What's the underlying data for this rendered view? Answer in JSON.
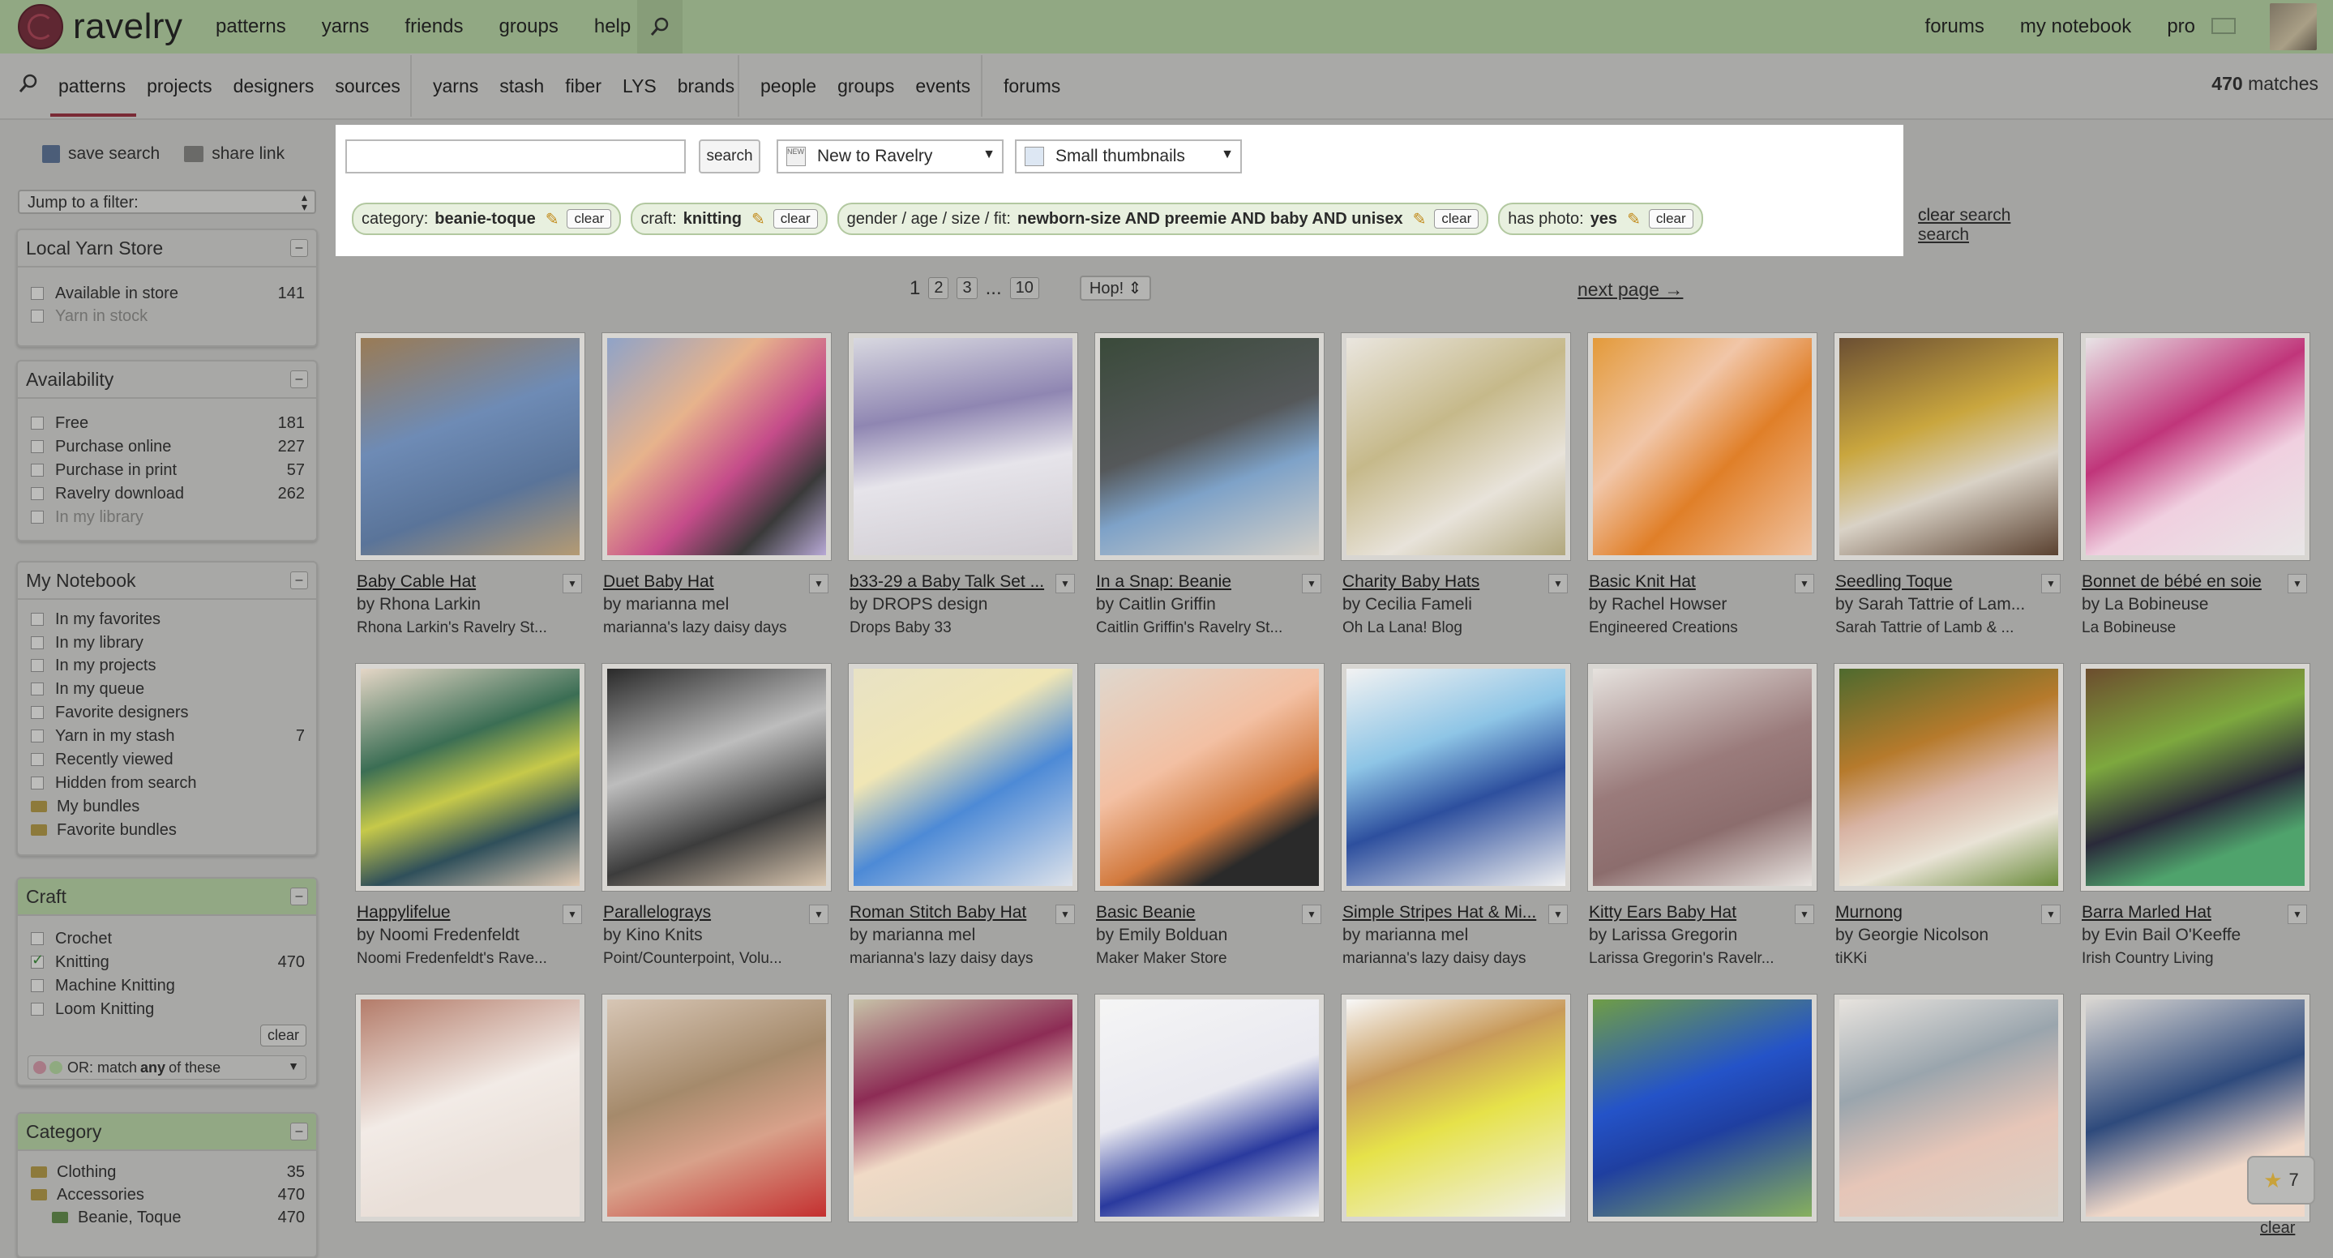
{
  "brand": "ravelry",
  "topnav": [
    "patterns",
    "yarns",
    "friends",
    "groups",
    "help"
  ],
  "topright": [
    "forums",
    "my notebook",
    "pro"
  ],
  "subnav": {
    "g1": [
      "patterns",
      "projects",
      "designers",
      "sources"
    ],
    "g2": [
      "yarns",
      "stash",
      "fiber",
      "LYS",
      "brands"
    ],
    "g3": [
      "people",
      "groups",
      "events"
    ],
    "g4": [
      "forums"
    ]
  },
  "matches": {
    "count": "470",
    "label": "matches"
  },
  "sidebar": {
    "save_search": "save search",
    "share_link": "share link",
    "jump": "Jump to a filter:",
    "lys": {
      "title": "Local Yarn Store",
      "items": [
        {
          "label": "Available in store",
          "count": "141"
        },
        {
          "label": "Yarn in stock",
          "count": ""
        }
      ]
    },
    "availability": {
      "title": "Availability",
      "items": [
        {
          "label": "Free",
          "count": "181"
        },
        {
          "label": "Purchase online",
          "count": "227"
        },
        {
          "label": "Purchase in print",
          "count": "57"
        },
        {
          "label": "Ravelry download",
          "count": "262"
        },
        {
          "label": "In my library",
          "count": ""
        }
      ]
    },
    "notebook": {
      "title": "My Notebook",
      "items": [
        {
          "label": "In my favorites",
          "count": ""
        },
        {
          "label": "In my library",
          "count": ""
        },
        {
          "label": "In my projects",
          "count": ""
        },
        {
          "label": "In my queue",
          "count": ""
        },
        {
          "label": "Favorite designers",
          "count": ""
        },
        {
          "label": "Yarn in my stash",
          "count": "7"
        },
        {
          "label": "Recently viewed",
          "count": ""
        },
        {
          "label": "Hidden from search",
          "count": ""
        },
        {
          "label": "My bundles",
          "count": ""
        },
        {
          "label": "Favorite bundles",
          "count": ""
        }
      ]
    },
    "craft": {
      "title": "Craft",
      "items": [
        {
          "label": "Crochet",
          "count": ""
        },
        {
          "label": "Knitting",
          "count": "470"
        },
        {
          "label": "Machine Knitting",
          "count": ""
        },
        {
          "label": "Loom Knitting",
          "count": ""
        }
      ],
      "clear": "clear",
      "or_prefix": "OR: match ",
      "or_any": "any",
      "or_suffix": " of these"
    },
    "category": {
      "title": "Category",
      "items": [
        {
          "label": "Clothing",
          "count": "35"
        },
        {
          "label": "Accessories",
          "count": "470"
        },
        {
          "label": "Beanie, Toque",
          "count": "470"
        }
      ]
    }
  },
  "search": {
    "button": "search",
    "sort": "New to Ravelry",
    "view": "Small thumbnails",
    "chips": [
      {
        "key": "category:",
        "value": "beanie-toque",
        "clear": "clear"
      },
      {
        "key": "craft:",
        "value": "knitting",
        "clear": "clear"
      },
      {
        "key": "gender / age / size / fit:",
        "value": "newborn-size AND preemie AND baby AND unisex",
        "clear": "clear"
      },
      {
        "key": "has photo:",
        "value": "yes",
        "clear": "clear"
      }
    ],
    "clear_search": "clear search"
  },
  "pager": {
    "current": "1",
    "p2": "2",
    "p3": "3",
    "ellipsis": "...",
    "last": "10",
    "hop": "Hop!",
    "next": "next page →"
  },
  "patterns": [
    {
      "title": "Baby Cable Hat",
      "by": "by Rhona Larkin",
      "src": "Rhona Larkin's Ravelry St..."
    },
    {
      "title": "Duet Baby Hat",
      "by": "by marianna mel",
      "src": "marianna's lazy daisy days"
    },
    {
      "title": "b33-29 a Baby Talk Set ...",
      "by": "by DROPS design",
      "src": "Drops Baby 33"
    },
    {
      "title": "In a Snap: Beanie",
      "by": "by Caitlin Griffin",
      "src": "Caitlin Griffin's Ravelry St..."
    },
    {
      "title": "Charity Baby Hats",
      "by": "by Cecilia Fameli",
      "src": "Oh La Lana! Blog"
    },
    {
      "title": "Basic Knit Hat",
      "by": "by Rachel Howser",
      "src": "Engineered Creations"
    },
    {
      "title": "Seedling Toque",
      "by": "by Sarah Tattrie of Lam...",
      "src": "Sarah Tattrie of Lamb & ..."
    },
    {
      "title": "Bonnet de bébé en soie",
      "by": "by La Bobineuse",
      "src": "La Bobineuse"
    },
    {
      "title": "Happylifelue",
      "by": "by Noomi Fredenfeldt",
      "src": "Noomi Fredenfeldt's Rave..."
    },
    {
      "title": "Parallelograys",
      "by": "by Kino Knits",
      "src": "Point/Counterpoint, Volu..."
    },
    {
      "title": "Roman Stitch Baby Hat",
      "by": "by marianna mel",
      "src": "marianna's lazy daisy days"
    },
    {
      "title": "Basic Beanie",
      "by": "by Emily Bolduan",
      "src": "Maker Maker Store"
    },
    {
      "title": "Simple Stripes Hat & Mi...",
      "by": "by marianna mel",
      "src": "marianna's lazy daisy days"
    },
    {
      "title": "Kitty Ears Baby Hat",
      "by": "by Larissa Gregorin",
      "src": "Larissa Gregorin's Ravelr..."
    },
    {
      "title": "Murnong",
      "by": "by Georgie Nicolson",
      "src": "tiKKi"
    },
    {
      "title": "Barra Marled Hat",
      "by": "by Evin Bail O'Keeffe",
      "src": "Irish Country Living"
    },
    {
      "title": "",
      "by": "",
      "src": ""
    },
    {
      "title": "",
      "by": "",
      "src": ""
    },
    {
      "title": "",
      "by": "",
      "src": ""
    },
    {
      "title": "",
      "by": "",
      "src": ""
    },
    {
      "title": "",
      "by": "",
      "src": ""
    },
    {
      "title": "",
      "by": "",
      "src": ""
    },
    {
      "title": "",
      "by": "",
      "src": ""
    },
    {
      "title": "",
      "by": "",
      "src": ""
    }
  ],
  "favorites": {
    "count": "7"
  },
  "bottom_clear": "clear"
}
